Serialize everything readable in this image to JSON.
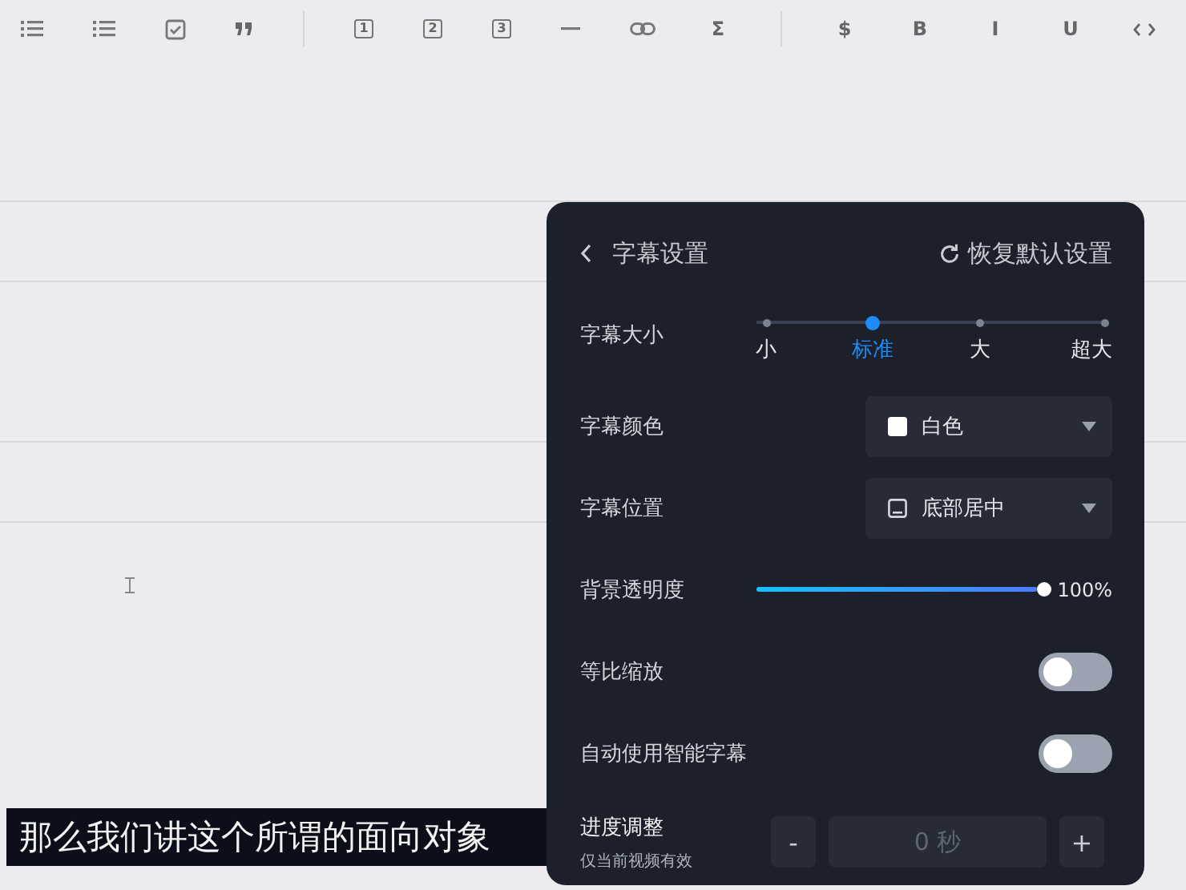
{
  "toolbar": [
    {
      "kind": "bullet-list"
    },
    {
      "kind": "bullet-list"
    },
    {
      "kind": "task"
    },
    {
      "kind": "quote"
    },
    {
      "kind": "separator"
    },
    {
      "kind": "boxed",
      "label": "1"
    },
    {
      "kind": "boxed",
      "label": "2"
    },
    {
      "kind": "boxed",
      "label": "3"
    },
    {
      "kind": "rule"
    },
    {
      "kind": "link"
    },
    {
      "kind": "glyph",
      "label": "Σ"
    },
    {
      "kind": "separator"
    },
    {
      "kind": "glyph",
      "label": "$"
    },
    {
      "kind": "glyph",
      "label": "B"
    },
    {
      "kind": "glyph",
      "label": "I"
    },
    {
      "kind": "glyph",
      "label": "U"
    },
    {
      "kind": "code"
    }
  ],
  "subtitle": "那么我们讲这个所谓的面向对象",
  "panel": {
    "back_title": "字幕设置",
    "reset": "恢复默认设置",
    "size": {
      "label": "字幕大小",
      "steps": [
        {
          "label": "小",
          "selected": false
        },
        {
          "label": "标准",
          "selected": true
        },
        {
          "label": "大",
          "selected": false
        },
        {
          "label": "超大",
          "selected": false
        }
      ]
    },
    "color": {
      "label": "字幕颜色",
      "value": "白色"
    },
    "position": {
      "label": "字幕位置",
      "value": "底部居中"
    },
    "opacity": {
      "label": "背景透明度",
      "level": 1,
      "reading": "100%"
    },
    "toggles": [
      {
        "label": "等比缩放",
        "on": false
      },
      {
        "label": "自动使用智能字幕",
        "on": false
      }
    ],
    "offset": {
      "label": "进度调整",
      "hint": "仅当前视频有效",
      "minus": "-",
      "placeholder": "0 秒",
      "plus": "+"
    }
  }
}
